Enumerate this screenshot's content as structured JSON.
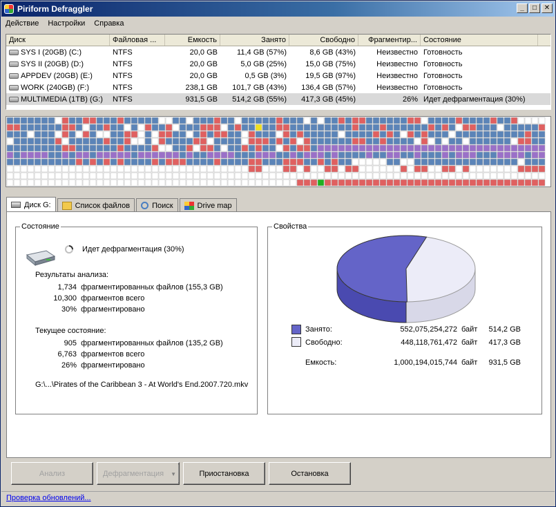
{
  "window": {
    "title": "Piriform Defraggler"
  },
  "menu": [
    "Действие",
    "Настройки",
    "Справка"
  ],
  "drive_list": {
    "columns": [
      "Диск",
      "Файловая ...",
      "Емкость",
      "Занято",
      "Свободно",
      "Фрагментир...",
      "Состояние"
    ],
    "rows": [
      [
        "SYS I (20GB) (C:)",
        "NTFS",
        "20,0 GB",
        "11,4 GB (57%)",
        "8,6 GB (43%)",
        "Неизвестно",
        "Готовность"
      ],
      [
        "SYS II (20GB) (D:)",
        "NTFS",
        "20,0 GB",
        "5,0 GB (25%)",
        "15,0 GB (75%)",
        "Неизвестно",
        "Готовность"
      ],
      [
        "APPDEV (20GB) (E:)",
        "NTFS",
        "20,0 GB",
        "0,5 GB (3%)",
        "19,5 GB (97%)",
        "Неизвестно",
        "Готовность"
      ],
      [
        "WORK (240GB) (F:)",
        "NTFS",
        "238,1 GB",
        "101,7 GB (43%)",
        "136,4 GB (57%)",
        "Неизвестно",
        "Готовность"
      ],
      [
        "MULTIMEDIA (1TB) (G:)",
        "NTFS",
        "931,5 GB",
        "514,2 GB (55%)",
        "417,3 GB (45%)",
        "26%",
        "Идет дефрагментация (30%)"
      ]
    ]
  },
  "tabs": [
    {
      "label": "Диск G:",
      "icon": "hdd-icon",
      "color": "#8a8a8a"
    },
    {
      "label": "Список файлов",
      "icon": "folder-icon",
      "color": "#f2c94c"
    },
    {
      "label": "Поиск",
      "icon": "magnifier-icon",
      "color": "#4a7fc1"
    },
    {
      "label": "Drive map",
      "icon": "drive-map-icon",
      "color": "#5a9a5a"
    }
  ],
  "state": {
    "legend": "Состояние",
    "status_text": "Идет дефрагментация (30%)",
    "analysis_title": "Результаты анализа:",
    "analysis": [
      {
        "value": "1,734",
        "label": "фрагментированных файлов (155,3 GB)"
      },
      {
        "value": "10,300",
        "label": "фрагментов всего"
      },
      {
        "value": "30%",
        "label": "фрагментировано"
      }
    ],
    "current_title": "Текущее состояние:",
    "current": [
      {
        "value": "905",
        "label": "фрагментированных файлов (135,2 GB)"
      },
      {
        "value": "6,763",
        "label": "фрагментов всего"
      },
      {
        "value": "26%",
        "label": "фрагментировано"
      }
    ],
    "current_file": "G:\\...\\Pirates of the Caribbean 3 - At World's End.2007.720.mkv"
  },
  "properties": {
    "legend": "Свойства",
    "used_label": "Занято:",
    "used_bytes": "552,075,254,272",
    "used_unit": "байт",
    "used_gb": "514,2 GB",
    "free_label": "Свободно:",
    "free_bytes": "448,118,761,472",
    "free_unit": "байт",
    "free_gb": "417,3 GB",
    "capacity_label": "Емкость:",
    "capacity_bytes": "1,000,194,015,744",
    "capacity_unit": "байт",
    "capacity_gb": "931,5 GB",
    "used_fraction": 0.55,
    "used_color": "#6464c8",
    "free_color": "#ececf8"
  },
  "buttons": {
    "analyze": "Анализ",
    "defrag": "Дефрагментация",
    "pause": "Приостановка",
    "stop": "Остановка"
  },
  "status_link": "Проверка обновлений...",
  "map_colors": {
    "used": "#5b84b8",
    "frag": "#e06060",
    "free": "#ffffff",
    "purple": "#9a70c8",
    "yellow": "#f0e020",
    "green": "#20b020"
  }
}
